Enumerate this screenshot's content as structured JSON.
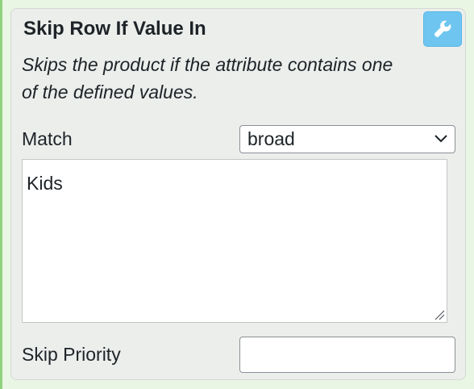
{
  "panel": {
    "title": "Skip Row If Value In",
    "tool_icon": "wrench-icon",
    "description_line1": "Skips the product if the attribute contains one",
    "description_line2": "of the defined values."
  },
  "match": {
    "label": "Match",
    "selected": "broad",
    "icon": "chevron-down-icon"
  },
  "values": {
    "text": "Kids"
  },
  "priority": {
    "label": "Skip Priority",
    "value": ""
  },
  "colors": {
    "accent": "#6ec6f0",
    "panel_background": "#eceeec",
    "page_background": "#e9f6e4",
    "left_border": "#8fd27f"
  }
}
